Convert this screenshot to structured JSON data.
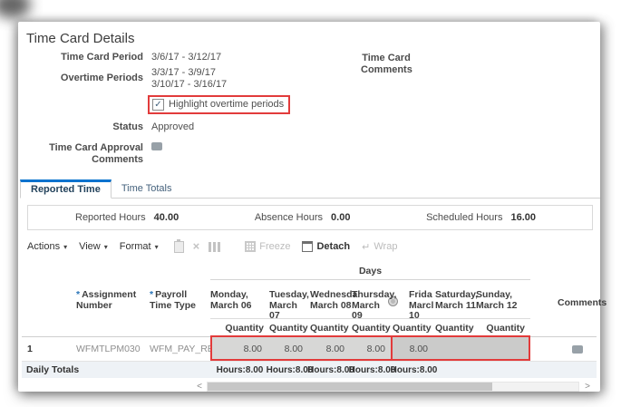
{
  "window": {
    "title": "Time Card Details"
  },
  "icons": {
    "dropdown": "▾",
    "check": "✓",
    "delete_x": "×",
    "wrap_glyph": "↵",
    "scroll_left": "<",
    "scroll_right": ">"
  },
  "form": {
    "period_label": "Time Card Period",
    "period_value": "3/6/17 - 3/12/17",
    "overtime_label": "Overtime Periods",
    "overtime_value1": "3/3/17 - 3/9/17",
    "overtime_value2": "3/10/17 - 3/16/17",
    "highlight_checkbox_label": "Highlight overtime periods",
    "status_label": "Status",
    "status_value": "Approved",
    "approval_comments_label": "Time Card Approval Comments",
    "comments_label_line1": "Time Card",
    "comments_label_line2": "Comments"
  },
  "tabs": {
    "reported": "Reported Time",
    "totals": "Time Totals"
  },
  "summary": {
    "reported_label": "Reported Hours",
    "reported_value": "40.00",
    "absence_label": "Absence Hours",
    "absence_value": "0.00",
    "scheduled_label": "Scheduled Hours",
    "scheduled_value": "16.00"
  },
  "toolbar": {
    "actions": "Actions",
    "view": "View",
    "format": "Format",
    "freeze": "Freeze",
    "detach": "Detach",
    "wrap": "Wrap"
  },
  "table": {
    "days_header": "Days",
    "required_marker": "*",
    "assignment_header": "Assignment Number",
    "payroll_header": "Payroll Time Type",
    "comments_header": "Comments",
    "day_columns": [
      {
        "l1": "Monday,",
        "l2": "March 06",
        "qty": "Quantity"
      },
      {
        "l1": "Tuesday,",
        "l2": "March 07",
        "qty": "Quantity"
      },
      {
        "l1": "Wednesda",
        "l2": "March 08",
        "qty": "Quantity"
      },
      {
        "l1": "Thursday,",
        "l2": "March 09",
        "qty": "Quantity"
      },
      {
        "l1": "Frida",
        "l2": "Marcl",
        "l3": "10",
        "qty": "Quantity"
      },
      {
        "l1": "Saturday,",
        "l2": "March 11",
        "qty": "Quantity"
      },
      {
        "l1": "Sunday,",
        "l2": "March 12",
        "qty": "Quantity"
      }
    ],
    "rows": [
      {
        "num": "1",
        "assignment": "WFMTLPM030",
        "payroll": "WFM_PAY_REG...",
        "q0": "8.00",
        "q1": "8.00",
        "q2": "8.00",
        "q3": "8.00",
        "q4": "8.00",
        "q5": "",
        "q6": ""
      }
    ],
    "daily_totals": {
      "label": "Daily Totals",
      "t0": "Hours:8.00",
      "t1": "Hours:8.00",
      "t2": "Hours:8.00",
      "t3": "Hours:8.00",
      "t4": "Hours:8.00"
    }
  },
  "colors": {
    "accent_blue": "#0572ce",
    "highlight_red": "#e23b3b",
    "overtime_cell_light": "#d7d7d6",
    "overtime_cell_dark": "#cbcbca",
    "totals_row_bg": "#eef2f6"
  }
}
